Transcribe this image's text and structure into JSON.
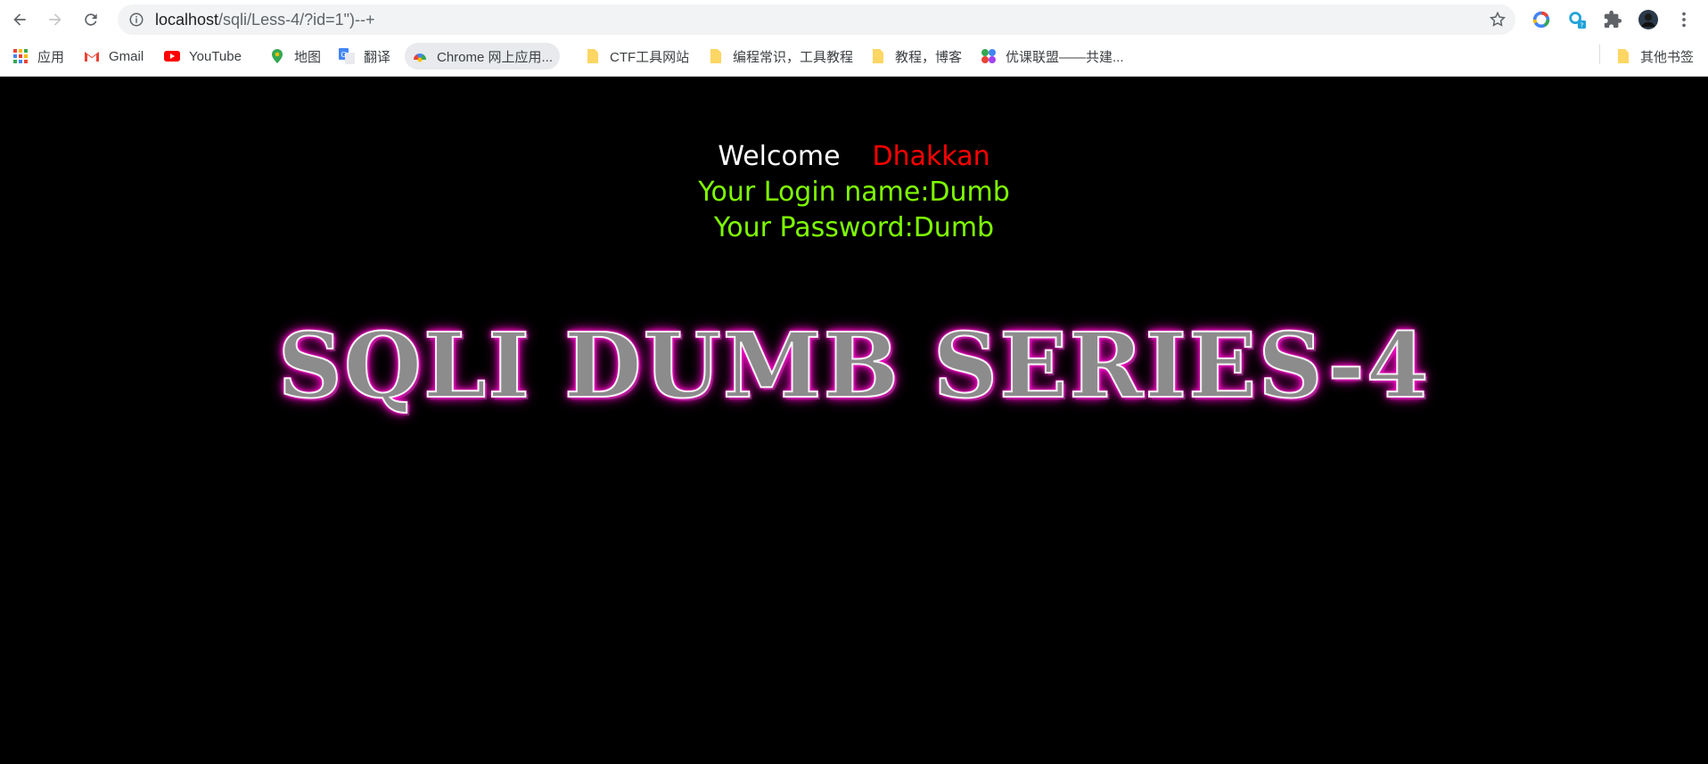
{
  "browser": {
    "url_host": "localhost",
    "url_path": "/sqli/Less-4/?id=1\")--+",
    "bookmarks": [
      {
        "label": "应用",
        "icon": "apps-grid-icon"
      },
      {
        "label": "Gmail",
        "icon": "gmail-icon"
      },
      {
        "label": "YouTube",
        "icon": "youtube-icon"
      },
      {
        "label": "地图",
        "icon": "maps-pin-icon"
      },
      {
        "label": "翻译",
        "icon": "translate-icon"
      },
      {
        "label": "Chrome 网上应用...",
        "icon": "chrome-webstore-icon"
      },
      {
        "label": "CTF工具网站",
        "icon": "folder-icon"
      },
      {
        "label": "编程常识，工具教程",
        "icon": "folder-icon"
      },
      {
        "label": "教程，博客",
        "icon": "folder-icon"
      },
      {
        "label": "优课联盟——共建...",
        "icon": "colorful-logo-icon"
      },
      {
        "label": "其他书签",
        "icon": "folder-icon"
      }
    ]
  },
  "page": {
    "welcome": "Welcome",
    "name": "Dhakkan",
    "login_line": "Your Login name:Dumb",
    "password_line": "Your Password:Dumb",
    "banner": "SQLI DUMB SERIES-4"
  },
  "colors": {
    "background": "#000000",
    "welcome": "#ffffff",
    "name": "#ff0000",
    "result": "#7fff00",
    "banner_glow": "#ff00cc"
  }
}
